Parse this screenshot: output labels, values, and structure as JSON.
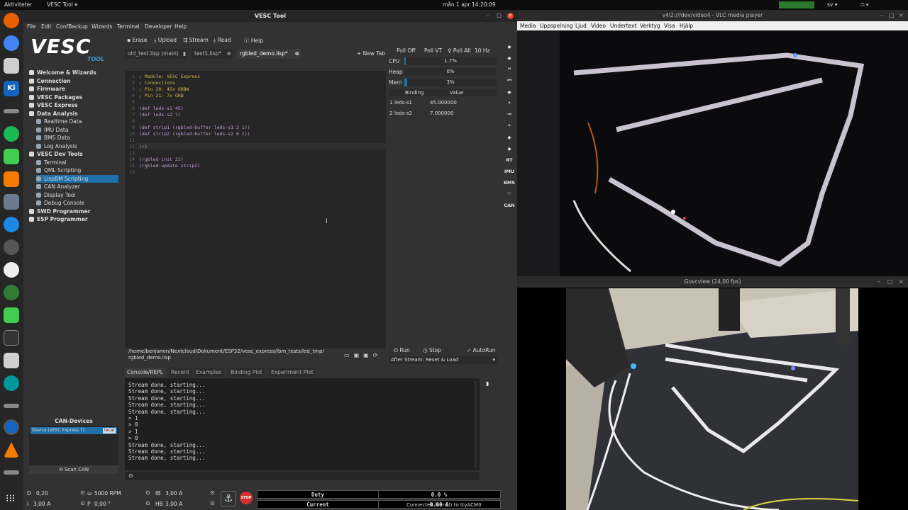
{
  "topbar": {
    "activities": "Aktiviteter",
    "app": "VESC Tool ▾",
    "clock": "mån 1 apr 14:20:09",
    "lang": "sv ▾"
  },
  "vesc": {
    "title": "VESC Tool",
    "menu": [
      "File",
      "Edit",
      "ConfBackup",
      "Wizards",
      "Terminal",
      "Developer",
      "Help"
    ],
    "logo_text": "VESC",
    "logo_sub": "TOOL",
    "nav": [
      {
        "label": "Welcome & Wizards",
        "bold": true,
        "indent": 0
      },
      {
        "label": "Connection",
        "bold": true,
        "indent": 0
      },
      {
        "label": "Firmware",
        "bold": true,
        "indent": 0
      },
      {
        "label": "VESC Packages",
        "bold": true,
        "indent": 0
      },
      {
        "label": "VESC Express",
        "bold": true,
        "indent": 0
      },
      {
        "label": "Data Analysis",
        "bold": true,
        "indent": 0
      },
      {
        "label": "Realtime Data",
        "bold": false,
        "indent": 1
      },
      {
        "label": "IMU Data",
        "bold": false,
        "indent": 1
      },
      {
        "label": "BMS Data",
        "bold": false,
        "indent": 1
      },
      {
        "label": "Log Analysis",
        "bold": false,
        "indent": 1
      },
      {
        "label": "VESC Dev Tools",
        "bold": true,
        "indent": 0
      },
      {
        "label": "Terminal",
        "bold": false,
        "indent": 1
      },
      {
        "label": "QML Scripting",
        "bold": false,
        "indent": 1
      },
      {
        "label": "LispBM Scripting",
        "bold": false,
        "indent": 1,
        "selected": true
      },
      {
        "label": "CAN Analyzer",
        "bold": false,
        "indent": 1
      },
      {
        "label": "Display Tool",
        "bold": false,
        "indent": 1
      },
      {
        "label": "Debug Console",
        "bold": false,
        "indent": 1
      },
      {
        "label": "SWD Programmer",
        "bold": true,
        "indent": 0
      },
      {
        "label": "ESP Programmer",
        "bold": true,
        "indent": 0
      }
    ],
    "toolbar": {
      "erase": "Erase",
      "upload": "Upload",
      "stream": "Stream",
      "read": "Read",
      "help": "Help"
    },
    "tabs": [
      {
        "label": "old_test.lisp (main)"
      },
      {
        "label": "test1.lisp*"
      },
      {
        "label": "rgbled_demo.lisp*",
        "active": true
      }
    ],
    "new_tab": "+ New Tab",
    "code": [
      "; Module: VESC Express",
      "; Connections",
      "; Pin 20: 45x GRBW",
      "; Pin 21: 7x GRB",
      "",
      "(def leds-s1 45)",
      "(def leds-s2 7)",
      "",
      "(def strip1 (rgbled-buffer leds-s1 2 1))",
      "(def strip2 (rgbled-buffer leds-s2 0 1))",
      "",
      "(r)",
      "",
      "(rgbled-init 21)",
      "(rgbled-update strip2)",
      ""
    ],
    "filepath": "/home/benjamin/Nextcloud/Dokument/ESP32/vesc_express/lbm_tests/led_tmp/\nrgbled_demo.lisp",
    "poll": {
      "off": "Poll Off",
      "vt": "Poll VT",
      "all": "Poll All",
      "hz": "10 Hz"
    },
    "stats": [
      {
        "label": "CPU",
        "value": "1.7%",
        "level": 0.017
      },
      {
        "label": "Heap",
        "value": "0%",
        "level": 0
      },
      {
        "label": "Mem",
        "value": "3%",
        "level": 0.03
      }
    ],
    "bindings": {
      "headers": [
        "Binding",
        "Value"
      ],
      "rows": [
        {
          "idx": "1",
          "name": "leds-s1",
          "value": "45.000000"
        },
        {
          "idx": "2",
          "name": "leds-s2",
          "value": "7.000000"
        }
      ]
    },
    "run": {
      "run": "Run",
      "stop": "Stop",
      "autorun": "AutoRun",
      "after": "After Stream: Reset & Load"
    },
    "console_tabs": [
      "Console/REPL",
      "Recent",
      "Examples",
      "Binding Plot",
      "Experiment Plot"
    ],
    "console_lines": [
      "Stream done, starting...",
      "Stream done, starting...",
      "Stream done, starting...",
      "Stream done, starting...",
      "Stream done, starting...",
      "> 1",
      "> 0",
      "> 1",
      "> 0",
      "Stream done, starting...",
      "Stream done, starting...",
      "Stream done, starting..."
    ],
    "can": {
      "title": "CAN-Devices",
      "device": "Device (VESC Express T):",
      "local": "local",
      "scan": "Scan CAN"
    },
    "rtools": [
      "",
      "",
      "ᴹ",
      "ᶜᴹ",
      "",
      "ᴬ",
      "ᶜᴬ",
      "ᴬ",
      "",
      "",
      "RT",
      "IMU",
      "BMS",
      "♡",
      "CAN"
    ],
    "bottom": {
      "d": "D",
      "d_val": "0,20",
      "w": "ω",
      "w_val": "5000 RPM",
      "ib": "IB",
      "ib_val": "3,00 A",
      "i": "I",
      "i_val": "3,00 A",
      "p": "P",
      "p_val": "0,00 °",
      "hb": "HB",
      "hb_val": "3,00 A",
      "duty_label": "Duty",
      "duty_val": "0.0 %",
      "current_label": "Current",
      "current_val": "0.00 A",
      "stop": "STOP",
      "status": "Connected (serial) to ttyACM0"
    }
  },
  "vlc": {
    "title": "v4l2:///dev/video4 - VLC media player",
    "menu": [
      "Media",
      "Uppspelning",
      "Ljud",
      "Video",
      "Undertext",
      "Verktyg",
      "Visa",
      "Hjälp"
    ]
  },
  "guvc": {
    "title": "Guvcview  (24,00 fps)"
  }
}
